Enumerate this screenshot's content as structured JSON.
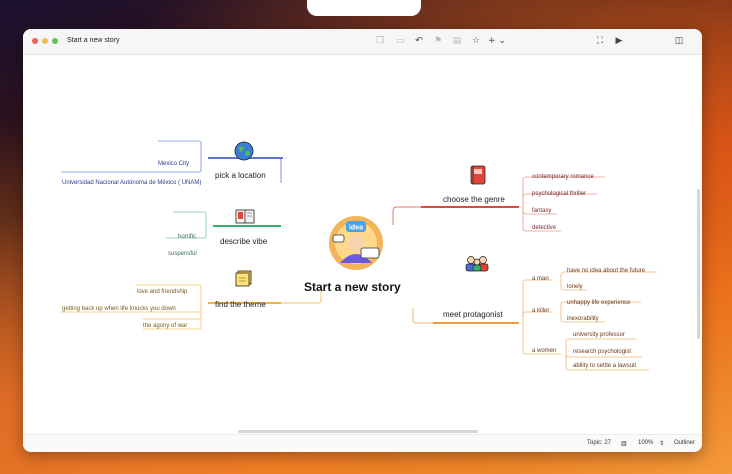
{
  "window": {
    "title": "Start a new story"
  },
  "toolbar": {
    "icons": [
      "copy-icon",
      "tag-icon",
      "undo-icon",
      "flag-icon",
      "comment-icon",
      "star-icon",
      "add-icon",
      "fit-icon",
      "present-icon",
      "sidebar-icon"
    ],
    "add_label": "+ ⌄"
  },
  "mindmap": {
    "central": "Start a new story",
    "left": [
      {
        "label": "pick a location",
        "icon": "globe-icon",
        "color": "#5b74d6",
        "children": [
          "Mexico City",
          "Universidad Nacional Autónoma de México ( UNAM)"
        ]
      },
      {
        "label": "describe vibe",
        "icon": "book-icon",
        "color": "#3aaa6a",
        "children": [
          "horrific",
          "suspensful"
        ]
      },
      {
        "label": "find the theme",
        "icon": "sticky-note-icon",
        "color": "#f0b83a",
        "children": [
          "love and friendship",
          "getting back up when life knocks you down",
          "the agony of war"
        ]
      }
    ],
    "right": [
      {
        "label": "choose the genre",
        "icon": "notebook-icon",
        "color": "#e0473a",
        "children": [
          "contemporary romance",
          "psychological thriller",
          "fantasy",
          "detective"
        ]
      },
      {
        "label": "meet protagonist",
        "icon": "people-icon",
        "color": "#f09a3a",
        "children": [
          {
            "label": "a  man",
            "children": [
              "have no idea about the future",
              "lonely"
            ]
          },
          {
            "label": "a  killer",
            "children": [
              "unhappy life experience",
              "inexorability"
            ]
          },
          {
            "label": "a women",
            "children": [
              "university professor",
              "research psychologist",
              "ability to settle a lawsuit"
            ]
          }
        ]
      }
    ]
  },
  "status": {
    "topic_count": "Topic: 27",
    "zoom": "100%",
    "outliner": "Outliner"
  }
}
